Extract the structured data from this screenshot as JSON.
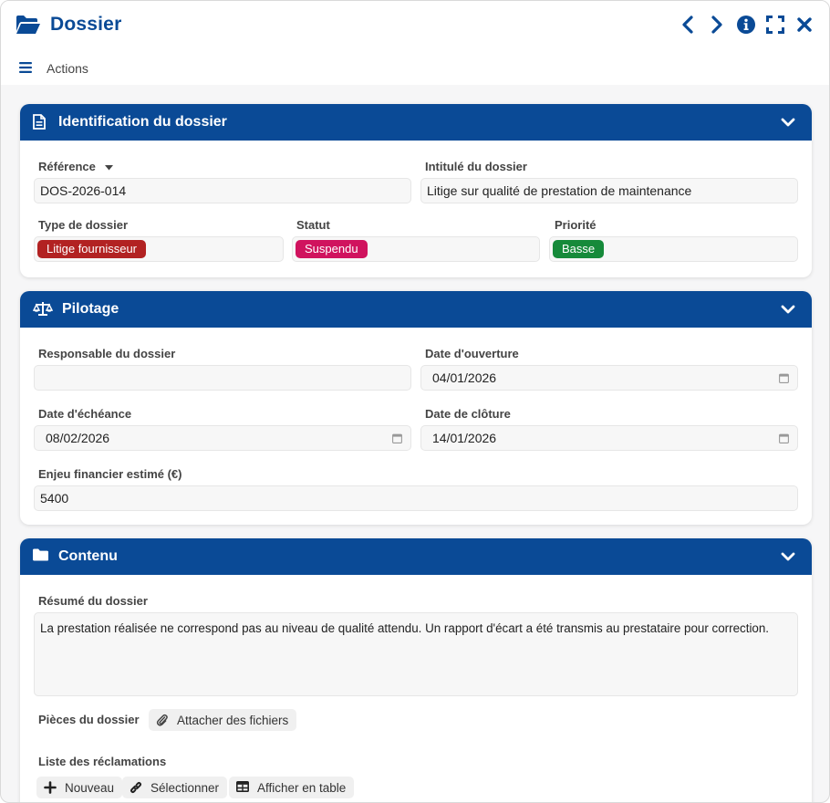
{
  "window": {
    "title": "Dossier",
    "icons": {
      "title": "folder-open-icon",
      "previous": "chevron-left-icon",
      "next": "chevron-right-icon",
      "info": "info-icon",
      "fullscreen": "expand-icon",
      "close": "close-icon"
    },
    "actions_label": "Actions"
  },
  "sections": {
    "identification": {
      "title": "Identification du dossier",
      "icon": "document-icon",
      "reference_label": "Référence",
      "reference_value": "DOS-2026-014",
      "intitule_label": "Intitulé du dossier",
      "intitule_value": "Litige sur qualité de prestation de maintenance",
      "type_label": "Type de dossier",
      "type_value": "Litige fournisseur",
      "type_color": "#b22222",
      "statut_label": "Statut",
      "statut_value": "Suspendu",
      "statut_color": "#d0135e",
      "priorite_label": "Priorité",
      "priorite_value": "Basse",
      "priorite_color": "#168a3a"
    },
    "pilotage": {
      "title": "Pilotage",
      "icon": "balance-scale-icon",
      "responsable_label": "Responsable du dossier",
      "responsable_value": "",
      "ouverture_label": "Date d'ouverture",
      "ouverture_value": "04/01/2026",
      "echeance_label": "Date d'échéance",
      "echeance_value": "08/02/2026",
      "cloture_label": "Date de clôture",
      "cloture_value": "14/01/2026",
      "enjeu_label": "Enjeu financier estimé (€)",
      "enjeu_value": "5400"
    },
    "contenu": {
      "title": "Contenu",
      "icon": "folder-icon",
      "resume_label": "Résumé du dossier",
      "resume_value": "La prestation réalisée ne correspond pas au niveau de qualité attendu. Un rapport d'écart a été transmis au prestataire pour correction.",
      "pieces_label": "Pièces du dossier",
      "attach_label": "Attacher des fichiers",
      "reclamations_label": "Liste des réclamations",
      "new_label": "Nouveau",
      "select_label": "Sélectionner",
      "table_label": "Afficher en table"
    }
  },
  "colors": {
    "primary": "#0a4a96",
    "background": "#f6f6f7"
  }
}
